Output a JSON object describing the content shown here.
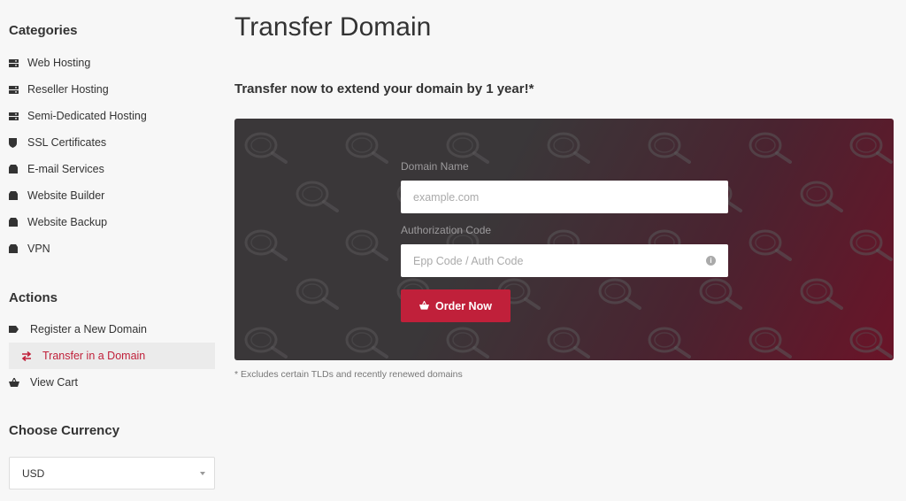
{
  "sidebar": {
    "categories_heading": "Categories",
    "categories": [
      {
        "label": "Web Hosting",
        "icon": "server-icon"
      },
      {
        "label": "Reseller Hosting",
        "icon": "server-icon"
      },
      {
        "label": "Semi-Dedicated Hosting",
        "icon": "server-icon"
      },
      {
        "label": "SSL Certificates",
        "icon": "shield-icon"
      },
      {
        "label": "E-mail Services",
        "icon": "box-icon"
      },
      {
        "label": "Website Builder",
        "icon": "box-icon"
      },
      {
        "label": "Website Backup",
        "icon": "box-icon"
      },
      {
        "label": "VPN",
        "icon": "box-icon"
      }
    ],
    "actions_heading": "Actions",
    "actions": [
      {
        "label": "Register a New Domain",
        "icon": "tag-icon",
        "active": false
      },
      {
        "label": "Transfer in a Domain",
        "icon": "transfer-arrows-icon",
        "active": true
      },
      {
        "label": "View Cart",
        "icon": "cart-icon",
        "active": false
      }
    ],
    "currency_heading": "Choose Currency",
    "currency_selected": "USD"
  },
  "main": {
    "title": "Transfer Domain",
    "subtitle": "Transfer now to extend your domain by 1 year!*",
    "form": {
      "domain_label": "Domain Name",
      "domain_placeholder": "example.com",
      "auth_label": "Authorization Code",
      "auth_placeholder": "Epp Code / Auth Code",
      "order_label": "Order Now"
    },
    "footnote": "* Excludes certain TLDs and recently renewed domains"
  },
  "colors": {
    "accent": "#c0203a",
    "panel_dark": "#3a3739",
    "panel_red": "#6a1428",
    "background": "#f7f7f7"
  }
}
